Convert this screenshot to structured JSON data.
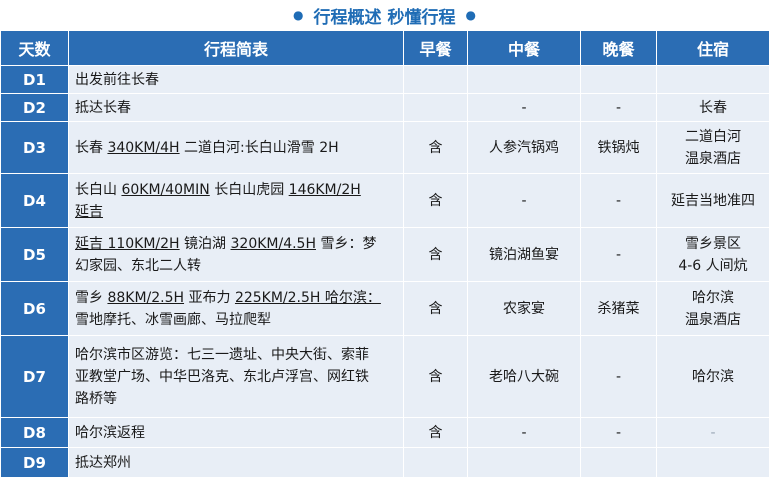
{
  "title": {
    "dot_left": "●",
    "text": "行程概述 秒懂行程",
    "dot_right": "●"
  },
  "headers": [
    "天数",
    "行程简表",
    "早餐",
    "中餐",
    "晚餐",
    "住宿"
  ],
  "rows": [
    {
      "day": "D1",
      "route": [
        {
          "t": "出发前往长春"
        }
      ],
      "breakfast": "",
      "lunch": "",
      "dinner": "",
      "hotel": ""
    },
    {
      "day": "D2",
      "route": [
        {
          "t": "抵达长春"
        }
      ],
      "breakfast": "",
      "lunch": "-",
      "dinner": "-",
      "hotel": "长春"
    },
    {
      "day": "D3",
      "route": [
        {
          "t": "长春 "
        },
        {
          "t": "340KM/4H",
          "u": true
        },
        {
          "t": " 二道白河:长白山滑雪 2H"
        }
      ],
      "breakfast": "含",
      "lunch": "人参汽锅鸡",
      "dinner": "铁锅炖",
      "hotel": "二道白河\n温泉酒店"
    },
    {
      "day": "D4",
      "route": [
        {
          "t": "长白山 "
        },
        {
          "t": "60KM/40MIN",
          "u": true
        },
        {
          "t": " 长白山虎园 "
        },
        {
          "t": "146KM/2H",
          "u": true
        },
        {
          "t": "\n"
        },
        {
          "t": "延吉",
          "u": true
        }
      ],
      "breakfast": "含",
      "lunch": "-",
      "dinner": "-",
      "hotel": "延吉当地准四"
    },
    {
      "day": "D5",
      "route": [
        {
          "t": "延吉",
          "u": true
        },
        {
          "t": " 110KM/2H",
          "u": true
        },
        {
          "t": " 镜泊湖 "
        },
        {
          "t": "320KM/4.5H",
          "u": true
        },
        {
          "t": " 雪乡：梦\n幻家园、东北二人转"
        }
      ],
      "breakfast": "含",
      "lunch": "镜泊湖鱼宴",
      "dinner": "-",
      "hotel": "雪乡景区\n4-6 人间炕"
    },
    {
      "day": "D6",
      "route": [
        {
          "t": "雪乡 "
        },
        {
          "t": "88KM/2.5H",
          "u": true
        },
        {
          "t": " 亚布力 "
        },
        {
          "t": "225KM/2.5H",
          "u": true
        },
        {
          "t": " 哈尔滨：\n",
          "u": true
        },
        {
          "t": "雪地摩托、冰雪画廊、马拉爬犁"
        }
      ],
      "breakfast": "含",
      "lunch": "农家宴",
      "dinner": "杀猪菜",
      "hotel": "哈尔滨\n温泉酒店"
    },
    {
      "day": "D7",
      "route": [
        {
          "t": "哈尔滨市区游览：七三一遗址、中央大街、索菲\n亚教堂广场、中华巴洛克、东北卢浮宫、网红铁\n路桥等"
        }
      ],
      "breakfast": "含",
      "lunch": "老哈八大碗",
      "dinner": "-",
      "hotel": "哈尔滨"
    },
    {
      "day": "D8",
      "route": [
        {
          "t": "哈尔滨返程"
        }
      ],
      "breakfast": "含",
      "lunch": "-",
      "dinner": "-",
      "hotel": "-"
    },
    {
      "day": "D9",
      "route": [
        {
          "t": "抵达郑州"
        }
      ],
      "breakfast": "",
      "lunch": "",
      "dinner": "",
      "hotel": ""
    }
  ]
}
